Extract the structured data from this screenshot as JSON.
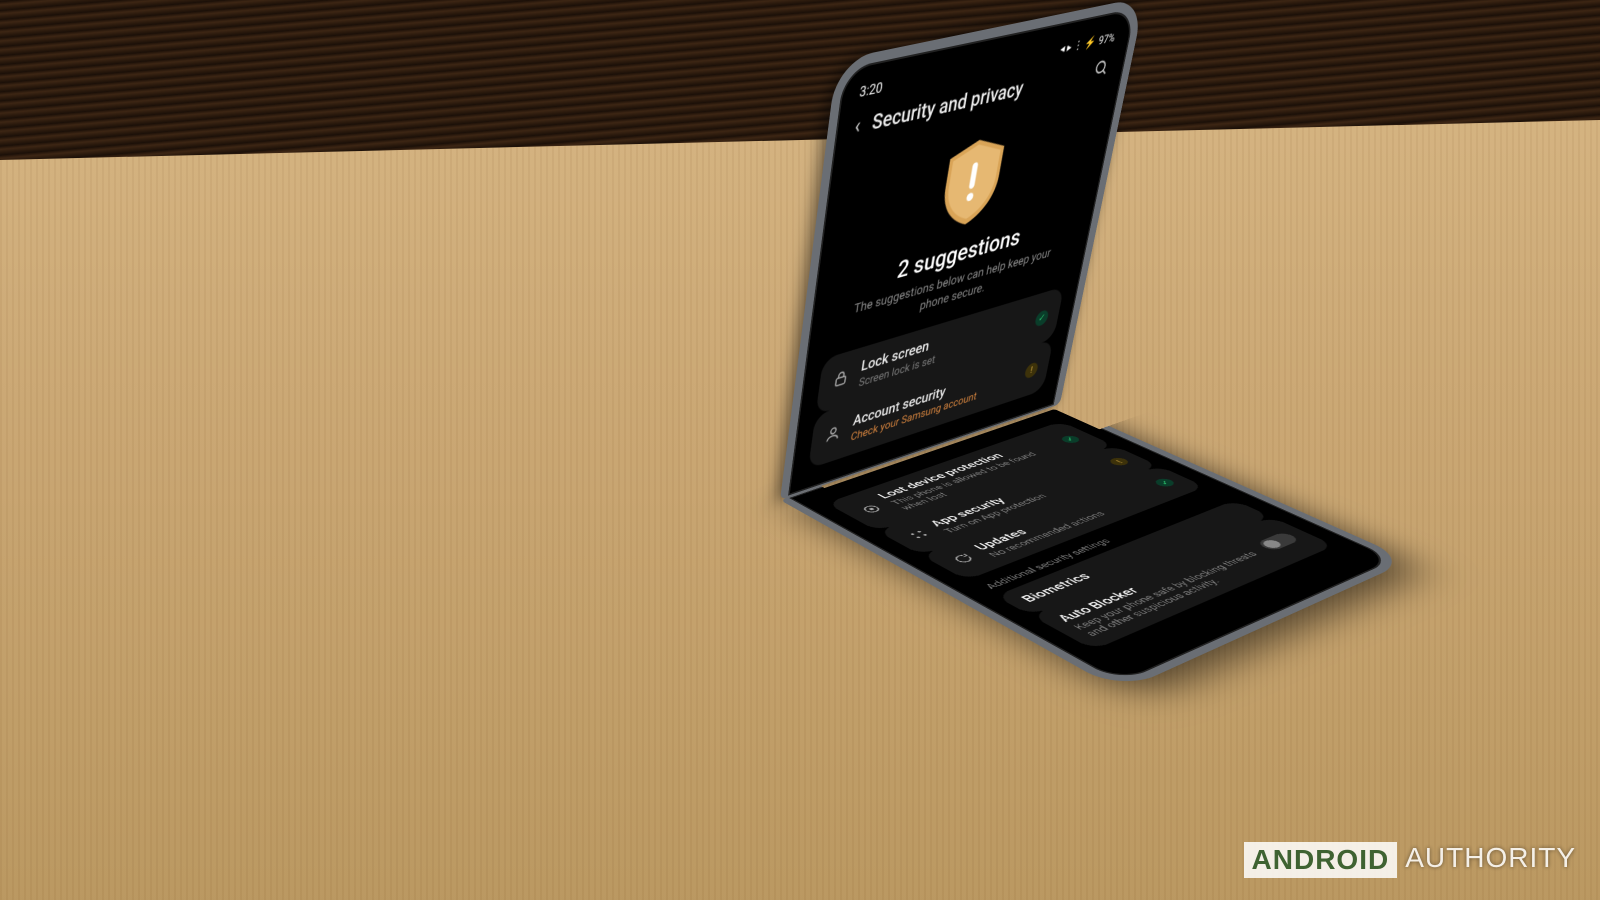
{
  "statusbar": {
    "time": "3:20",
    "battery": "97%",
    "signal_icons": "◂ ▸ ⋮ ⚡"
  },
  "titlebar": {
    "title": "Security and privacy"
  },
  "hero": {
    "heading": "2 suggestions",
    "sub": "The suggestions below can help keep your phone secure."
  },
  "rows_top": [
    {
      "icon": "lock",
      "title": "Lock screen",
      "sub": "Screen lock is set",
      "badge": "ok"
    },
    {
      "icon": "user",
      "title": "Account security",
      "sub": "Check your Samsung account",
      "badge": "warn",
      "warn": true
    }
  ],
  "rows_bottom": [
    {
      "icon": "locate",
      "title": "Lost device protection",
      "sub": "This phone is allowed to be found when lost",
      "badge": "ok"
    },
    {
      "icon": "apps",
      "title": "App security",
      "sub": "Turn on App protection",
      "badge": "warn"
    },
    {
      "icon": "refresh",
      "title": "Updates",
      "sub": "No recommended actions",
      "badge": "ok"
    }
  ],
  "subhead": "Additional security settings",
  "extra": [
    {
      "title": "Biometrics"
    },
    {
      "title": "Auto Blocker",
      "sub": "Keep your phone safe by blocking threats and other suspicious activity.",
      "toggle": false
    }
  ],
  "watermark": {
    "brand": "ANDROID",
    "rest": "AUTHORITY"
  }
}
